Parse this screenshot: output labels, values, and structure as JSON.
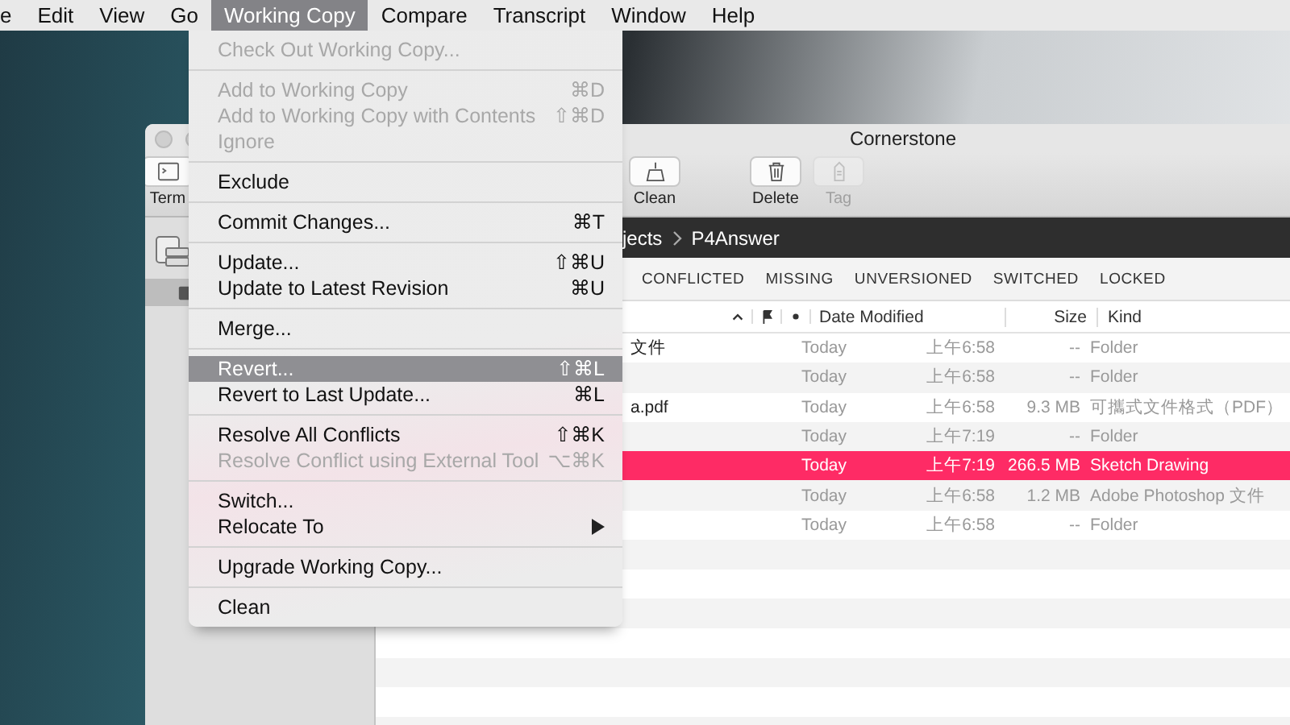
{
  "menu_bar": [
    {
      "label": "e",
      "selected": false
    },
    {
      "label": "Edit",
      "selected": false
    },
    {
      "label": "View",
      "selected": false
    },
    {
      "label": "Go",
      "selected": false
    },
    {
      "label": "Working Copy",
      "selected": true
    },
    {
      "label": "Compare",
      "selected": false
    },
    {
      "label": "Transcript",
      "selected": false
    },
    {
      "label": "Window",
      "selected": false
    },
    {
      "label": "Help",
      "selected": false
    }
  ],
  "window": {
    "title": "Cornerstone",
    "toolbar": [
      {
        "label": "Term",
        "disabled": false
      },
      {
        "label": "Clean",
        "disabled": false
      },
      {
        "label": "Delete",
        "disabled": false
      },
      {
        "label": "Tag",
        "disabled": true
      }
    ],
    "sidebar": {
      "items": [
        {
          "selected": true
        }
      ]
    },
    "path": [
      "jects",
      "P4Answer"
    ],
    "filters": [
      "CONFLICTED",
      "MISSING",
      "UNVERSIONED",
      "SWITCHED",
      "LOCKED"
    ],
    "table": {
      "columns": [
        "Date Modified",
        "Size",
        "Kind"
      ],
      "rows": [
        {
          "name": "文件",
          "date": "Today",
          "time": "上午6:58",
          "size": "--",
          "kind": "Folder",
          "selected": false
        },
        {
          "name": "",
          "date": "Today",
          "time": "上午6:58",
          "size": "--",
          "kind": "Folder",
          "selected": false
        },
        {
          "name": "a.pdf",
          "date": "Today",
          "time": "上午6:58",
          "size": "9.3 MB",
          "kind": "可攜式文件格式（PDF）",
          "selected": false
        },
        {
          "name": "",
          "date": "Today",
          "time": "上午7:19",
          "size": "--",
          "kind": "Folder",
          "selected": false
        },
        {
          "name": "",
          "date": "Today",
          "time": "上午7:19",
          "size": "266.5 MB",
          "kind": "Sketch Drawing",
          "selected": true
        },
        {
          "name": "",
          "date": "Today",
          "time": "上午6:58",
          "size": "1.2 MB",
          "kind": "Adobe Photoshop 文件",
          "selected": false
        },
        {
          "name": "",
          "date": "Today",
          "time": "上午6:58",
          "size": "--",
          "kind": "Folder",
          "selected": false
        }
      ]
    }
  },
  "menu": {
    "sections": [
      [
        {
          "label": "Check Out Working Copy...",
          "disabled": true,
          "selected": false,
          "submenu": false
        }
      ],
      [
        {
          "label": "Add to Working Copy",
          "shortcut": "⌘D",
          "disabled": true,
          "selected": false,
          "submenu": false
        },
        {
          "label": "Add to Working Copy with Contents",
          "shortcut": "⇧⌘D",
          "disabled": true,
          "selected": false,
          "submenu": false
        },
        {
          "label": "Ignore",
          "disabled": true,
          "selected": false,
          "submenu": false
        }
      ],
      [
        {
          "label": "Exclude",
          "disabled": false,
          "selected": false,
          "submenu": false
        }
      ],
      [
        {
          "label": "Commit Changes...",
          "shortcut": "⌘T",
          "disabled": false,
          "selected": false,
          "submenu": false
        }
      ],
      [
        {
          "label": "Update...",
          "shortcut": "⇧⌘U",
          "disabled": false,
          "selected": false,
          "submenu": false
        },
        {
          "label": "Update to Latest Revision",
          "shortcut": "⌘U",
          "disabled": false,
          "selected": false,
          "submenu": false
        }
      ],
      [
        {
          "label": "Merge...",
          "disabled": false,
          "selected": false,
          "submenu": false
        }
      ],
      [
        {
          "label": "Revert...",
          "shortcut": "⇧⌘L",
          "disabled": false,
          "selected": true,
          "submenu": false
        },
        {
          "label": "Revert to Last Update...",
          "shortcut": "⌘L",
          "disabled": false,
          "selected": false,
          "submenu": false
        }
      ],
      [
        {
          "label": "Resolve All Conflicts",
          "shortcut": "⇧⌘K",
          "disabled": false,
          "selected": false,
          "submenu": false
        },
        {
          "label": "Resolve Conflict using External Tool",
          "shortcut": "⌥⌘K",
          "disabled": true,
          "selected": false,
          "submenu": false
        }
      ],
      [
        {
          "label": "Switch...",
          "disabled": false,
          "selected": false,
          "submenu": false
        },
        {
          "label": "Relocate To",
          "disabled": false,
          "selected": false,
          "submenu": true
        }
      ],
      [
        {
          "label": "Upgrade Working Copy...",
          "disabled": false,
          "selected": false,
          "submenu": false
        }
      ],
      [
        {
          "label": "Clean",
          "disabled": false,
          "selected": false,
          "submenu": false
        }
      ]
    ]
  }
}
